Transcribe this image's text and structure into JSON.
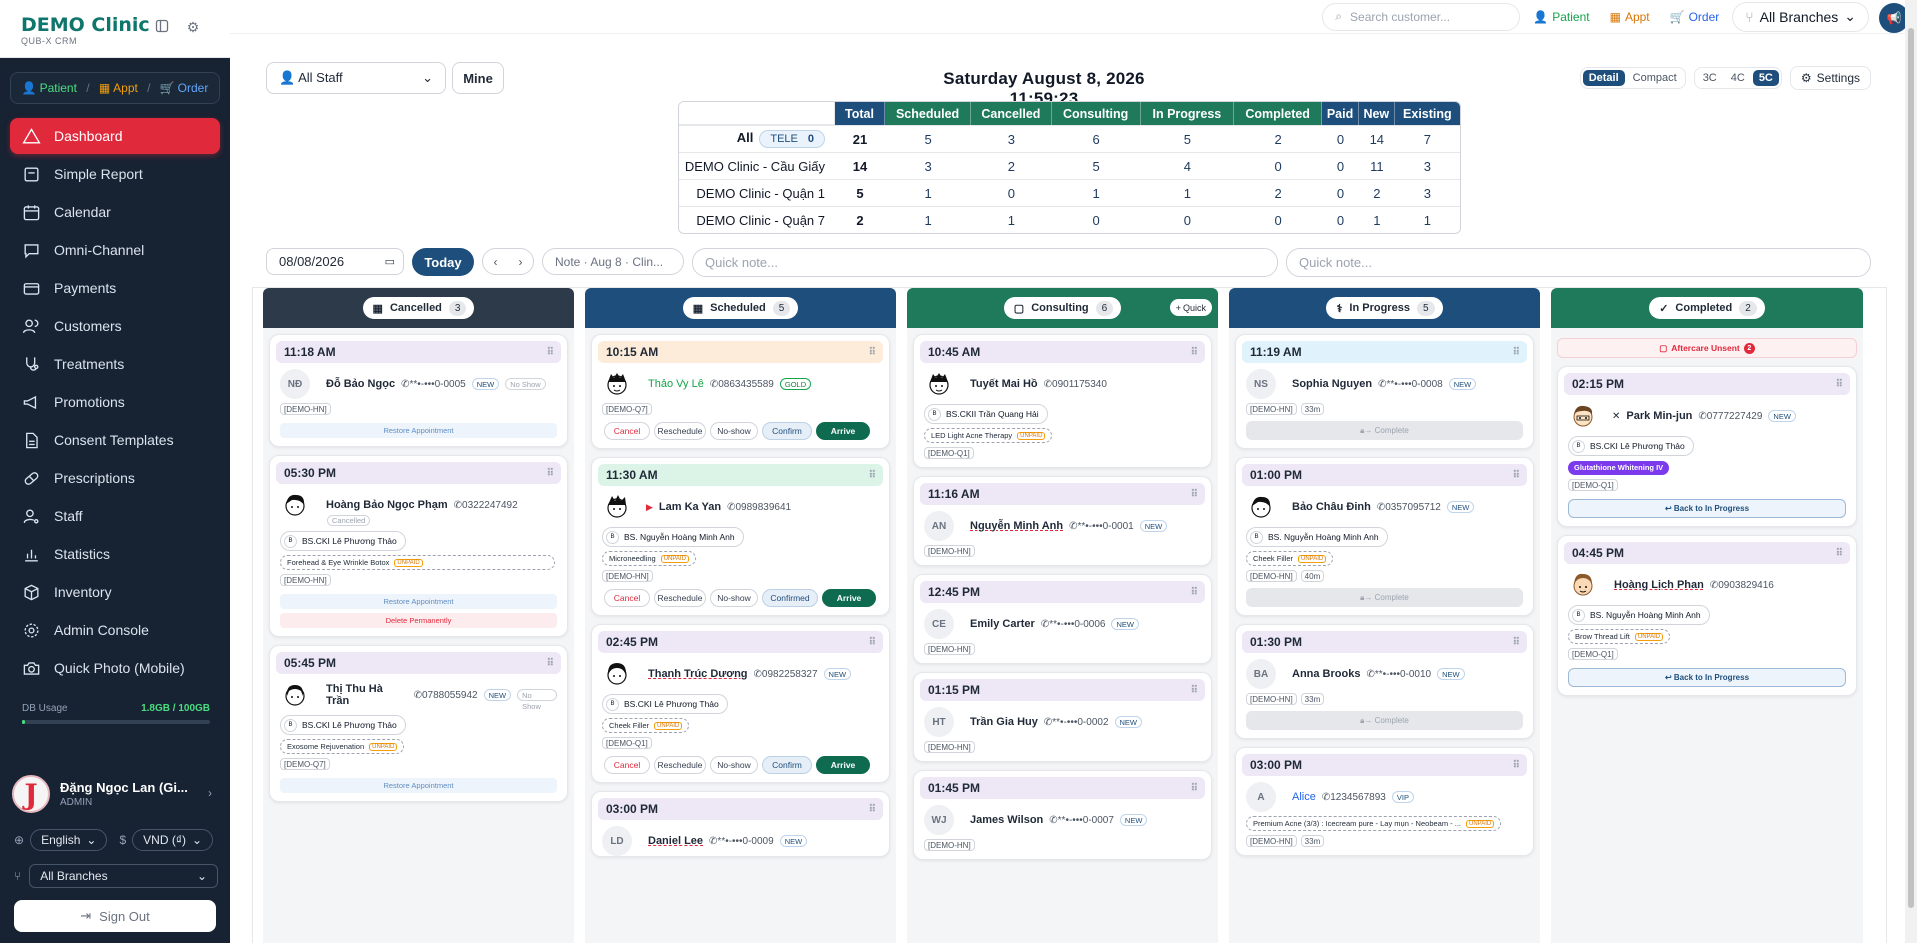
{
  "brand": {
    "name": "DEMO Clinic",
    "sub": "QUB-X CRM"
  },
  "quick_actions": [
    "Patient",
    "Appt",
    "Order"
  ],
  "nav": [
    "Dashboard",
    "Simple Report",
    "Calendar",
    "Omni-Channel",
    "Payments",
    "Customers",
    "Treatments",
    "Promotions",
    "Consent Templates",
    "Prescriptions",
    "Staff",
    "Statistics",
    "Inventory",
    "Admin Console",
    "Quick Photo (Mobile)"
  ],
  "db_usage": {
    "label": "DB Usage",
    "value": "1.8GB / 100GB",
    "fraction": 0.018
  },
  "user": {
    "initial": "J",
    "name": "Đặng Ngọc Lan (Gi...",
    "role": "ADMIN"
  },
  "language": "English",
  "currency": "VND (₫)",
  "branch": "All Branches",
  "signout": "Sign Out",
  "topbar": {
    "search_placeholder": "Search customer...",
    "patient": "Patient",
    "appt": "Appt",
    "order": "Order",
    "branch": "All Branches"
  },
  "filters": {
    "staff": "All Staff",
    "mine": "Mine"
  },
  "datetime": "Saturday August 8, 2026  11:59:23",
  "view": {
    "detail": "Detail",
    "compact": "Compact",
    "c3": "3C",
    "c4": "4C",
    "c5": "5C",
    "settings": "Settings"
  },
  "summary": {
    "headers": [
      "Total",
      "Scheduled",
      "Cancelled",
      "Consulting",
      "In Progress",
      "Completed",
      "Paid",
      "New",
      "Existing"
    ],
    "rows": [
      {
        "label": "All",
        "tele": "TELE",
        "tele_count": "0",
        "values": [
          "21",
          "5",
          "3",
          "6",
          "5",
          "2",
          "0",
          "14",
          "7"
        ]
      },
      {
        "label": "DEMO Clinic - Cầu Giấy",
        "values": [
          "14",
          "3",
          "2",
          "5",
          "4",
          "0",
          "0",
          "11",
          "3"
        ]
      },
      {
        "label": "DEMO Clinic - Quận 1",
        "values": [
          "5",
          "1",
          "0",
          "1",
          "1",
          "2",
          "0",
          "2",
          "3"
        ]
      },
      {
        "label": "DEMO Clinic - Quận 7",
        "values": [
          "2",
          "1",
          "1",
          "0",
          "0",
          "0",
          "0",
          "1",
          "1"
        ]
      }
    ]
  },
  "datebar": {
    "date": "08/08/2026",
    "today": "Today",
    "note": "Note · Aug 8 · Clin...",
    "quick1": "Quick note...",
    "quick2": "Quick note..."
  },
  "columns": [
    {
      "title": "Cancelled",
      "count": "3"
    },
    {
      "title": "Scheduled",
      "count": "5"
    },
    {
      "title": "Consulting",
      "count": "6",
      "quick": "Quick"
    },
    {
      "title": "In Progress",
      "count": "5"
    },
    {
      "title": "Completed",
      "count": "2"
    }
  ],
  "colors": {
    "sidebar": "#172232",
    "active": "#e02a3c",
    "navy": "#1e4f7c",
    "teal": "#0f6b4f",
    "green": "#1f7a5c",
    "slate": "#2d3a4a"
  },
  "labels": {
    "restore": "Restore Appointment",
    "delete": "Delete Permanently",
    "cancel": "Cancel",
    "reschedule": "Reschedule",
    "noshow": "No-show",
    "confirm": "Confirm",
    "confirmed": "Confirmed",
    "arrive": "Arrive",
    "complete": "→ Complete",
    "back": "↩ Back to In Progress",
    "aftercare": "Aftercare Unsent",
    "aftercare_n": "2",
    "unpaid": "UNPAID",
    "new": "NEW",
    "noshow_tag": "No Show",
    "cancelled_tag": "Cancelled",
    "gold": "GOLD",
    "vip": "VIP"
  },
  "cards": {
    "c1": {
      "time": "11:18 AM",
      "av": "NĐ",
      "name": "Đỗ Bảo Ngọc",
      "phone": "**•-•••0-0005",
      "branch": "[DEMO-HN]"
    },
    "c2": {
      "time": "05:30 PM",
      "name": "Hoàng Bảo Ngọc Phạm",
      "phone": "0322247492",
      "doctor": "BS.CKI Lê Phương Thảo",
      "service": "Forehead & Eye Wrinkle Botox",
      "branch": "[DEMO-HN]"
    },
    "c3": {
      "time": "05:45 PM",
      "name": "Thị Thu Hà Trần",
      "phone": "0788055942",
      "doctor": "BS.CKI Lê Phương Thảo",
      "service": "Exosome Rejuvenation",
      "branch": "[DEMO-Q7]"
    },
    "s1": {
      "time": "10:15 AM",
      "name": "Thảo Vy Lê",
      "phone": "0863435589",
      "branch": "[DEMO-Q7]"
    },
    "s2": {
      "time": "11:30 AM",
      "name": "Lam Ka Yan",
      "phone": "0989839641",
      "doctor": "BS. Nguyễn Hoàng Minh Anh",
      "service": "Microneedling",
      "branch": "[DEMO-HN]"
    },
    "s3": {
      "time": "02:45 PM",
      "name": "Thanh Trúc Dương",
      "phone": "0982258327",
      "doctor": "BS.CKI Lê Phương Thảo",
      "service": "Cheek Filler",
      "branch": "[DEMO-Q1]"
    },
    "s4": {
      "time": "03:00 PM",
      "av": "LD",
      "name": "Daniel Lee",
      "phone": "**•-•••0-0009"
    },
    "k1": {
      "time": "10:45 AM",
      "name": "Tuyết Mai Hồ",
      "phone": "0901175340",
      "doctor": "BS.CKII Trần Quang Hải",
      "service": "LED Light Acne Therapy",
      "branch": "[DEMO-Q1]"
    },
    "k2": {
      "time": "11:16 AM",
      "av": "AN",
      "name": "Nguyễn Minh Anh",
      "phone": "**•-•••0-0001",
      "branch": "[DEMO-HN]"
    },
    "k3": {
      "time": "12:45 PM",
      "av": "CE",
      "name": "Emily Carter",
      "phone": "**•-•••0-0006",
      "branch": "[DEMO-HN]"
    },
    "k4": {
      "time": "01:15 PM",
      "av": "HT",
      "name": "Trần Gia Huy",
      "phone": "**•-•••0-0002",
      "branch": "[DEMO-HN]"
    },
    "k5": {
      "time": "01:45 PM",
      "av": "WJ",
      "name": "James Wilson",
      "phone": "**•-•••0-0007",
      "branch": "[DEMO-HN]"
    },
    "p1": {
      "time": "11:19 AM",
      "av": "NS",
      "name": "Sophia Nguyen",
      "phone": "**•-•••0-0008",
      "branch": "[DEMO-HN]",
      "dur": "33m"
    },
    "p2": {
      "time": "01:00 PM",
      "name": "Bảo Châu Đinh",
      "phone": "0357095712",
      "doctor": "BS. Nguyễn Hoàng Minh Anh",
      "service": "Cheek Filler",
      "branch": "[DEMO-HN]",
      "dur": "40m"
    },
    "p3": {
      "time": "01:30 PM",
      "av": "BA",
      "name": "Anna Brooks",
      "phone": "**•-•••0-0010",
      "branch": "[DEMO-HN]",
      "dur": "33m"
    },
    "p4": {
      "time": "03:00 PM",
      "av": "A",
      "name": "Alice",
      "phone": "1234567893",
      "service": "Premium Acne (3/3) : Icecream pure - Lay mụn - Neobeam - ...",
      "branch": "[DEMO-HN]",
      "dur": "33m"
    },
    "d1": {
      "time": "02:15 PM",
      "name": "Park Min-jun",
      "phone": "0777227429",
      "doctor": "BS.CKI Lê Phương Thảo",
      "service": "Glutathione Whitening IV",
      "branch": "[DEMO-Q1]"
    },
    "d2": {
      "time": "04:45 PM",
      "name": "Hoàng Lịch Phan",
      "phone": "0903829416",
      "doctor": "BS. Nguyễn Hoàng Minh Anh",
      "service": "Brow Thread Lift",
      "branch": "[DEMO-Q1]"
    }
  }
}
